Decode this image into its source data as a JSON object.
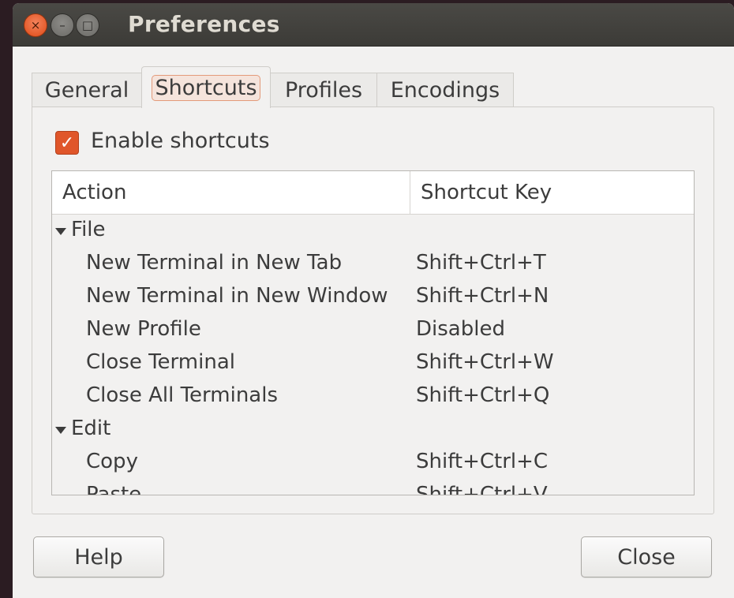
{
  "window": {
    "title": "Preferences",
    "close_glyph": "×",
    "minimize_glyph": "–",
    "maximize_glyph": "□"
  },
  "tabs": [
    {
      "label": "General",
      "active": false
    },
    {
      "label": "Shortcuts",
      "active": true
    },
    {
      "label": "Profiles",
      "active": false
    },
    {
      "label": "Encodings",
      "active": false
    }
  ],
  "enable_shortcuts": {
    "label": "Enable shortcuts",
    "checked": true,
    "check_glyph": "✓"
  },
  "table": {
    "columns": [
      "Action",
      "Shortcut Key"
    ],
    "rows": [
      {
        "type": "group",
        "action": "File",
        "shortcut": ""
      },
      {
        "type": "item",
        "action": "New Terminal in New Tab",
        "shortcut": "Shift+Ctrl+T"
      },
      {
        "type": "item",
        "action": "New Terminal in New Window",
        "shortcut": "Shift+Ctrl+N"
      },
      {
        "type": "item",
        "action": "New Profile",
        "shortcut": "Disabled"
      },
      {
        "type": "item",
        "action": "Close Terminal",
        "shortcut": "Shift+Ctrl+W"
      },
      {
        "type": "item",
        "action": "Close All Terminals",
        "shortcut": "Shift+Ctrl+Q"
      },
      {
        "type": "group",
        "action": "Edit",
        "shortcut": ""
      },
      {
        "type": "item",
        "action": "Copy",
        "shortcut": "Shift+Ctrl+C"
      },
      {
        "type": "item",
        "action": "Paste",
        "shortcut": "Shift+Ctrl+V"
      }
    ]
  },
  "buttons": {
    "help": "Help",
    "close": "Close"
  },
  "colors": {
    "accent": "#e0562a",
    "titlebar": "#3c3b37"
  }
}
